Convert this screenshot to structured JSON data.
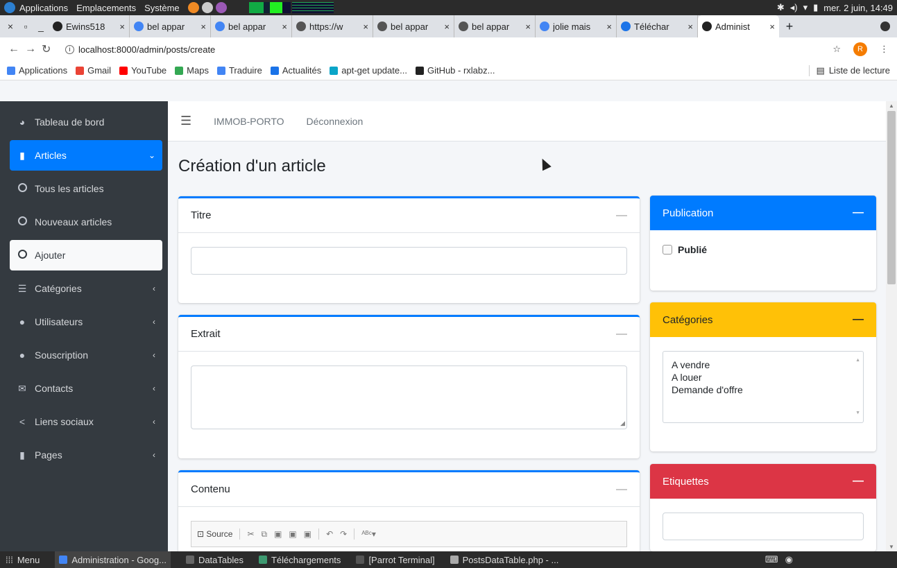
{
  "os": {
    "menus": [
      "Applications",
      "Emplacements",
      "Système"
    ],
    "datetime": "mer. 2 juin, 14:49"
  },
  "browser": {
    "tabs": [
      {
        "label": "Ewins518",
        "icon": "github-icon",
        "color": "#222222"
      },
      {
        "label": "bel appar",
        "icon": "google-icon",
        "color": "#4285f4"
      },
      {
        "label": "bel appar",
        "icon": "google-icon",
        "color": "#4285f4"
      },
      {
        "label": "https://w",
        "icon": "globe-icon",
        "color": "#555555"
      },
      {
        "label": "bel appar",
        "icon": "globe-icon",
        "color": "#555555"
      },
      {
        "label": "bel appar",
        "icon": "globe-icon",
        "color": "#555555"
      },
      {
        "label": "jolie mais",
        "icon": "google-icon",
        "color": "#4285f4"
      },
      {
        "label": "Téléchar",
        "icon": "download-icon",
        "color": "#1a73e8"
      },
      {
        "label": "Administ",
        "icon": "bootstrap-icon",
        "color": "#222222"
      }
    ],
    "url": "localhost:8000/admin/posts/create",
    "profile_initial": "R",
    "bookmarks": [
      {
        "label": "Applications",
        "icon": "apps-grid-icon",
        "color": "#4285f4"
      },
      {
        "label": "Gmail",
        "icon": "gmail-icon",
        "color": "#ea4335"
      },
      {
        "label": "YouTube",
        "icon": "youtube-icon",
        "color": "#ff0000"
      },
      {
        "label": "Maps",
        "icon": "maps-icon",
        "color": "#34a853"
      },
      {
        "label": "Traduire",
        "icon": "translate-icon",
        "color": "#4285f4"
      },
      {
        "label": "Actualités",
        "icon": "news-icon",
        "color": "#1a73e8"
      },
      {
        "label": "apt-get update...",
        "icon": "parrot-icon",
        "color": "#0aa5c8"
      },
      {
        "label": "GitHub - rxlabz...",
        "icon": "github-icon",
        "color": "#222222"
      }
    ],
    "reading_list": "Liste de lecture"
  },
  "sidebar": {
    "items": [
      {
        "label": "Tableau de bord",
        "icon": "dashboard-icon",
        "state": "normal",
        "chevron": ""
      },
      {
        "label": "Articles",
        "icon": "file-icon",
        "state": "active",
        "chevron": "⌄"
      },
      {
        "label": "Tous les articles",
        "icon": "circle-icon",
        "state": "normal",
        "chevron": ""
      },
      {
        "label": "Nouveaux articles",
        "icon": "circle-icon",
        "state": "normal",
        "chevron": ""
      },
      {
        "label": "Ajouter",
        "icon": "circle-icon",
        "state": "selected",
        "chevron": ""
      },
      {
        "label": "Catégories",
        "icon": "list-icon",
        "state": "normal",
        "chevron": "‹"
      },
      {
        "label": "Utilisateurs",
        "icon": "user-icon",
        "state": "normal",
        "chevron": "‹"
      },
      {
        "label": "Souscription",
        "icon": "comment-icon",
        "state": "normal",
        "chevron": "‹"
      },
      {
        "label": "Contacts",
        "icon": "envelope-icon",
        "state": "normal",
        "chevron": "‹"
      },
      {
        "label": "Liens sociaux",
        "icon": "share-icon",
        "state": "normal",
        "chevron": "‹"
      },
      {
        "label": "Pages",
        "icon": "file-icon",
        "state": "normal",
        "chevron": "‹"
      }
    ]
  },
  "topnav": {
    "brand": "IMMOB-PORTO",
    "logout": "Déconnexion"
  },
  "page": {
    "title": "Création d'un article"
  },
  "cards": {
    "titre": {
      "header": "Titre"
    },
    "extrait": {
      "header": "Extrait"
    },
    "contenu": {
      "header": "Contenu",
      "source_label": "Source"
    },
    "publication": {
      "header": "Publication",
      "color": "#007bff",
      "checkbox_label": "Publié"
    },
    "categories": {
      "header": "Catégories",
      "color": "#ffc107",
      "options": [
        "A vendre",
        "A louer",
        "Demande d'offre"
      ]
    },
    "etiquettes": {
      "header": "Etiquettes",
      "color": "#dc3545"
    }
  },
  "taskbar": {
    "menu": "Menu",
    "tasks": [
      {
        "label": "Administration - Goog...",
        "color": "#4285f4"
      },
      {
        "label": "DataTables",
        "color": "#666666"
      },
      {
        "label": "Téléchargements",
        "color": "#3d9970"
      },
      {
        "label": "[Parrot Terminal]",
        "color": "#555555"
      },
      {
        "label": "PostsDataTable.php - ...",
        "color": "#aaaaaa"
      }
    ]
  }
}
